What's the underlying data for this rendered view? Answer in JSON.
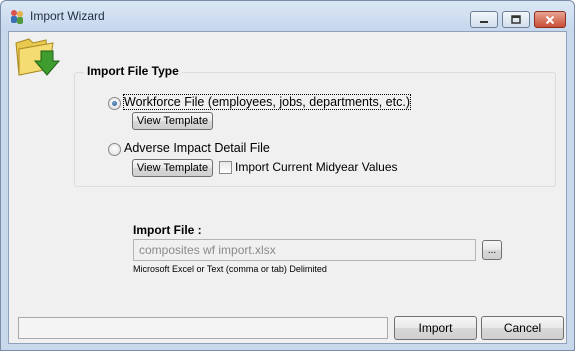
{
  "window": {
    "title": "Import Wizard",
    "controls": {
      "minimize": "minimize",
      "maximize": "maximize",
      "close": "close"
    }
  },
  "group": {
    "title": "Import File Type",
    "options": [
      {
        "label": "Workforce File (employees, jobs, departments, etc.)",
        "selected": true,
        "template_button": "View Template"
      },
      {
        "label": "Adverse Impact Detail File",
        "selected": false,
        "template_button": "View Template"
      }
    ],
    "midyear_checkbox": {
      "label": "Import Current Midyear Values",
      "checked": false
    }
  },
  "import_file": {
    "label": "Import File :",
    "value": "composites wf import.xlsx",
    "browse_label": "...",
    "hint": "Microsoft Excel or Text (comma or tab) Delimited"
  },
  "footer": {
    "status_text": "",
    "import_label": "Import",
    "cancel_label": "Cancel"
  },
  "colors": {
    "title_bar": "#c6d7ec",
    "close_button": "#c94d34",
    "dialog_bg": "#f0f0f0"
  }
}
